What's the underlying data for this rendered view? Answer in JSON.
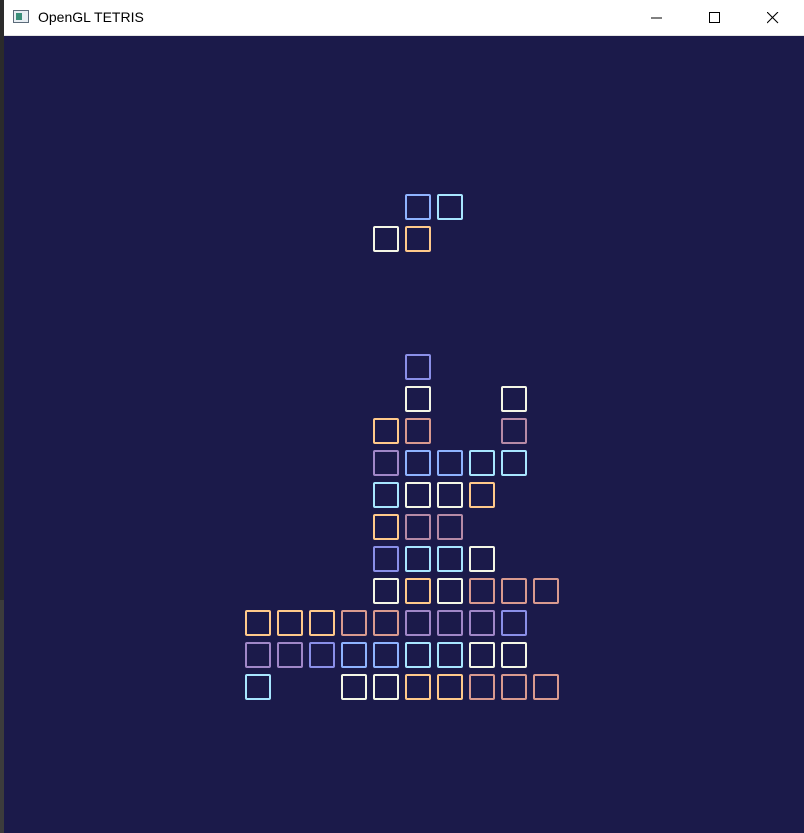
{
  "window": {
    "title": "OpenGL TETRIS",
    "icons": {
      "app": "window-app-icon",
      "minimize": "minimize-icon",
      "maximize": "maximize-icon",
      "close": "close-icon"
    }
  },
  "game": {
    "background": "#1b1a4a",
    "colors": {
      "cyan": "#a8e6ff",
      "blue": "#8fb3ff",
      "indigo": "#8a8fe8",
      "purple": "#a087c8",
      "mauve": "#b68aa6",
      "rose": "#d99a8f",
      "peach": "#ffc98a",
      "white": "#f4f6e6"
    },
    "falling_piece": [
      {
        "col": 5,
        "row": 6,
        "color": "blue"
      },
      {
        "col": 6,
        "row": 6,
        "color": "cyan"
      },
      {
        "col": 4,
        "row": 7,
        "color": "white"
      },
      {
        "col": 5,
        "row": 7,
        "color": "peach"
      }
    ],
    "stack": [
      {
        "col": 5,
        "row": 11,
        "color": "indigo"
      },
      {
        "col": 5,
        "row": 12,
        "color": "white"
      },
      {
        "col": 8,
        "row": 12,
        "color": "white"
      },
      {
        "col": 4,
        "row": 13,
        "color": "peach"
      },
      {
        "col": 5,
        "row": 13,
        "color": "rose"
      },
      {
        "col": 8,
        "row": 13,
        "color": "mauve"
      },
      {
        "col": 4,
        "row": 14,
        "color": "purple"
      },
      {
        "col": 5,
        "row": 14,
        "color": "blue"
      },
      {
        "col": 6,
        "row": 14,
        "color": "blue"
      },
      {
        "col": 7,
        "row": 14,
        "color": "cyan"
      },
      {
        "col": 8,
        "row": 14,
        "color": "cyan"
      },
      {
        "col": 4,
        "row": 15,
        "color": "cyan"
      },
      {
        "col": 5,
        "row": 15,
        "color": "white"
      },
      {
        "col": 6,
        "row": 15,
        "color": "white"
      },
      {
        "col": 7,
        "row": 15,
        "color": "peach"
      },
      {
        "col": 4,
        "row": 16,
        "color": "peach"
      },
      {
        "col": 5,
        "row": 16,
        "color": "mauve"
      },
      {
        "col": 6,
        "row": 16,
        "color": "mauve"
      },
      {
        "col": 4,
        "row": 17,
        "color": "indigo"
      },
      {
        "col": 5,
        "row": 17,
        "color": "cyan"
      },
      {
        "col": 6,
        "row": 17,
        "color": "cyan"
      },
      {
        "col": 7,
        "row": 17,
        "color": "white"
      },
      {
        "col": 4,
        "row": 18,
        "color": "white"
      },
      {
        "col": 5,
        "row": 18,
        "color": "peach"
      },
      {
        "col": 6,
        "row": 18,
        "color": "white"
      },
      {
        "col": 7,
        "row": 18,
        "color": "rose"
      },
      {
        "col": 8,
        "row": 18,
        "color": "rose"
      },
      {
        "col": 9,
        "row": 18,
        "color": "rose"
      },
      {
        "col": 0,
        "row": 19,
        "color": "peach"
      },
      {
        "col": 1,
        "row": 19,
        "color": "peach"
      },
      {
        "col": 2,
        "row": 19,
        "color": "peach"
      },
      {
        "col": 3,
        "row": 19,
        "color": "rose"
      },
      {
        "col": 4,
        "row": 19,
        "color": "rose"
      },
      {
        "col": 5,
        "row": 19,
        "color": "purple"
      },
      {
        "col": 6,
        "row": 19,
        "color": "purple"
      },
      {
        "col": 7,
        "row": 19,
        "color": "purple"
      },
      {
        "col": 8,
        "row": 19,
        "color": "indigo"
      },
      {
        "col": 0,
        "row": 20,
        "color": "purple"
      },
      {
        "col": 1,
        "row": 20,
        "color": "purple"
      },
      {
        "col": 2,
        "row": 20,
        "color": "indigo"
      },
      {
        "col": 3,
        "row": 20,
        "color": "blue"
      },
      {
        "col": 4,
        "row": 20,
        "color": "blue"
      },
      {
        "col": 5,
        "row": 20,
        "color": "cyan"
      },
      {
        "col": 6,
        "row": 20,
        "color": "cyan"
      },
      {
        "col": 7,
        "row": 20,
        "color": "white"
      },
      {
        "col": 8,
        "row": 20,
        "color": "white"
      },
      {
        "col": 0,
        "row": 21,
        "color": "cyan"
      },
      {
        "col": 3,
        "row": 21,
        "color": "white"
      },
      {
        "col": 4,
        "row": 21,
        "color": "white"
      },
      {
        "col": 5,
        "row": 21,
        "color": "peach"
      },
      {
        "col": 6,
        "row": 21,
        "color": "peach"
      },
      {
        "col": 7,
        "row": 21,
        "color": "rose"
      },
      {
        "col": 8,
        "row": 21,
        "color": "rose"
      },
      {
        "col": 9,
        "row": 21,
        "color": "rose"
      }
    ]
  }
}
